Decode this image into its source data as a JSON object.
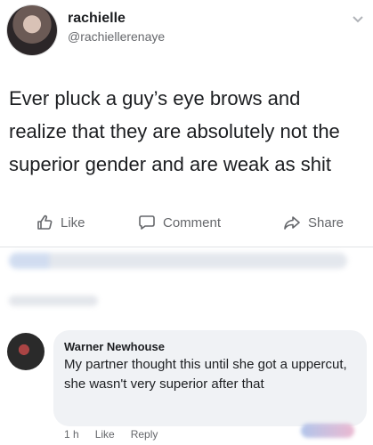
{
  "post": {
    "username": "rachielle",
    "handle": "@rachiellerenaye",
    "text": "Ever pluck a guy’s eye brows and realize that they are absolutely not the superior gender and are weak as shit",
    "actions": {
      "like": "Like",
      "comment": "Comment",
      "share": "Share"
    }
  },
  "comment": {
    "author": "Warner Newhouse",
    "text": "My partner thought this until she got a uppercut, she wasn't very superior after that",
    "meta": {
      "time": "1 h",
      "like": "Like",
      "reply": "Reply"
    }
  },
  "icons": {
    "like": "thumbs-up-icon",
    "comment": "comment-bubble-icon",
    "share": "share-arrow-icon",
    "menu": "chevron-down-icon"
  }
}
